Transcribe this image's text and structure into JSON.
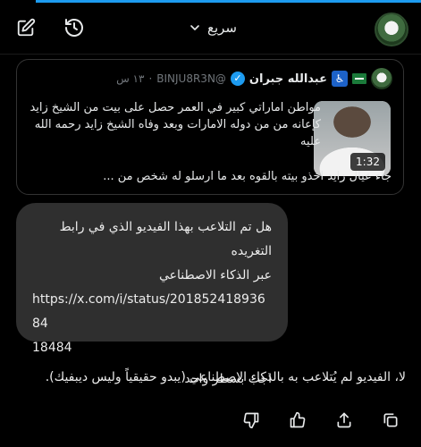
{
  "header": {
    "mode_label": "سريع",
    "icons": [
      "new-chat-icon",
      "history-icon",
      "chevron-down-icon"
    ],
    "accent_color": "#1d9bf0"
  },
  "quoted_post": {
    "author_name": "عبدالله جبران",
    "handle": "@BINJU8R3N",
    "time": "١٣ س",
    "dot": "·",
    "text_line1": "مواطن اماراتي كبير في العمر حصل على بيت من الشيخ زايد",
    "text_line2": "كإعانه من من دوله الامارات   وبعد وفاه الشيخ زايد رحمه الله",
    "text_line3": "عليه",
    "text_line4": "جاء عيال زايد اخذو بيته بالقوه بعد ما ارسلو له شخص من ...",
    "video_duration": "1:32"
  },
  "user_message": {
    "line1": "هل تم التلاعب بهذا الفيديو الذي في رابط التغريده",
    "line2": "عبر الذكاء الاصطناعي",
    "url_line1": "https://x.com/i/status/20185241893684",
    "url_line2": "18484",
    "line3": "اجب بسطر واحد"
  },
  "assistant_reply": {
    "text": "لا، الفيديو لم يُتلاعب به بالذكاء الاصطناعي (يبدو حقيقياً وليس ديبفيك)."
  },
  "actions": [
    "copy-icon",
    "share-icon",
    "like-icon",
    "dislike-icon"
  ]
}
